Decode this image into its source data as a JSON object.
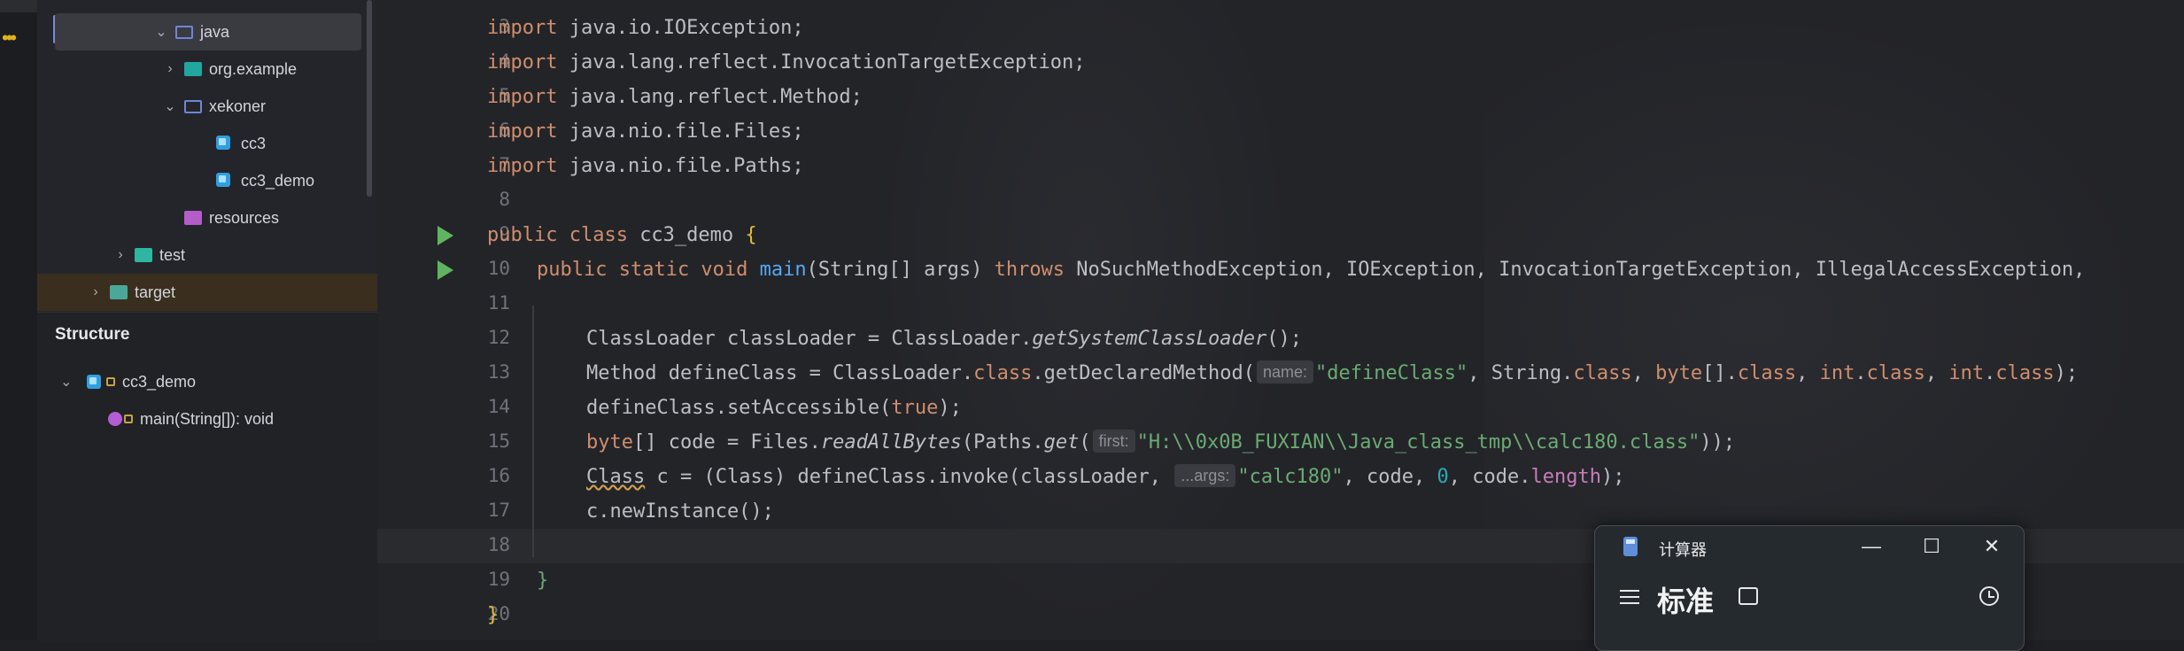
{
  "project_tree": {
    "items": [
      {
        "label": "java"
      },
      {
        "label": "org.example"
      },
      {
        "label": "xekoner"
      },
      {
        "label": "cc3"
      },
      {
        "label": "cc3_demo"
      },
      {
        "label": "resources"
      },
      {
        "label": "test"
      },
      {
        "label": "target"
      }
    ]
  },
  "structure": {
    "title": "Structure",
    "items": [
      {
        "label": "cc3_demo"
      },
      {
        "label": "main(String[]): void"
      }
    ]
  },
  "editor": {
    "line_numbers": [
      "3",
      "4",
      "5",
      "6",
      "7",
      "8",
      "9",
      "10",
      "11",
      "12",
      "13",
      "14",
      "15",
      "16",
      "17",
      "18",
      "19",
      "20"
    ],
    "lines": {
      "l3": "import java.io.IOException;",
      "l4": "import java.lang.reflect.InvocationTargetException;",
      "l5": "import java.lang.reflect.Method;",
      "l6": "import java.nio.file.Files;",
      "l7": "import java.nio.file.Paths;",
      "l9_kw": "public class ",
      "l9_name": "cc3_demo",
      "l9_brace": " {",
      "l10_kw": "public static void ",
      "l10_fn": "main",
      "l10_args": "(String[] args) ",
      "l10_throws": "throws",
      "l10_exc": " NoSuchMethodException, IOException, InvocationTargetException, IllegalAccessException,",
      "l12_a": "ClassLoader classLoader = ClassLoader.",
      "l12_b": "getSystemClassLoader",
      "l12_c": "();",
      "l13_a": "Method defineClass = ClassLoader.",
      "l13_kw1": "class",
      "l13_b": ".getDeclaredMethod(",
      "l13_hint": "name:",
      "l13_str": "\"defineClass\"",
      "l13_c": ", String.",
      "l13_kw2": "class",
      "l13_d": ", ",
      "l13_kw3": "byte",
      "l13_e": "[].",
      "l13_kw4": "class",
      "l13_f": ", ",
      "l13_kw5": "int",
      "l13_g": ".",
      "l13_kw6": "class",
      "l13_h": ", ",
      "l13_kw7": "int",
      "l13_i": ".",
      "l13_kw8": "class",
      "l13_j": ");",
      "l14_a": "defineClass.setAccessible(",
      "l14_kw": "true",
      "l14_b": ");",
      "l15_kw": "byte",
      "l15_a": "[] code = Files.",
      "l15_fn": "readAllBytes",
      "l15_b": "(Paths.",
      "l15_fn2": "get",
      "l15_c": "(",
      "l15_hint": "first:",
      "l15_str": "\"H:\\\\0x0B_FUXIAN\\\\Java_class_tmp\\\\calc180.class\"",
      "l15_d": "));",
      "l16_ty": "Class",
      "l16_a": " c = (",
      "l16_ty2": "Class",
      "l16_b": ") defineClass.invoke(classLoader, ",
      "l16_hint": "...args:",
      "l16_str": "\"calc180\"",
      "l16_c": ", code, ",
      "l16_num": "0",
      "l16_d": ", code.",
      "l16_field": "length",
      "l16_e": ");",
      "l17": "c.newInstance();",
      "l19": "}",
      "l20": "}"
    }
  },
  "calculator": {
    "title": "计算器",
    "mode": "标准",
    "minimize": "—",
    "maximize": "☐",
    "close": "✕"
  }
}
